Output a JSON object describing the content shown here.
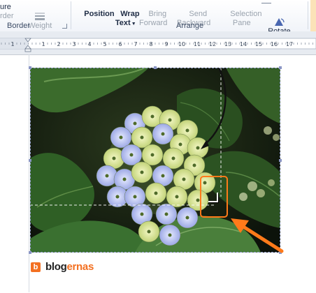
{
  "ribbon": {
    "border_group": {
      "label": "Border",
      "partial_top": "ure",
      "partial_bottom": "rder",
      "weight_label": "Weight"
    },
    "arrange_group": {
      "label": "Arrange",
      "position_label": "Position",
      "wrap_text_label": "Wrap\nText",
      "bring_forward_label": "Bring\nForward",
      "send_backward_label": "Send\nBackward",
      "selection_pane_label": "Selection\nPane",
      "rotate_label": "Rotate"
    }
  },
  "ruler": {
    "numbers": [
      "1",
      "1",
      "2",
      "3",
      "4",
      "5",
      "6",
      "7",
      "8",
      "9",
      "10",
      "11",
      "12",
      "13",
      "14",
      "15",
      "16",
      "17"
    ]
  },
  "logo": {
    "icon_letter": "b",
    "word_part1": "blog",
    "word_part2": "ernas",
    "color_dark": "#222222",
    "color_accent": "#f37021"
  },
  "colors": {
    "accent_orange": "#ff7a1a",
    "handle": "#8a95c4",
    "ribbon_text": "#1e2c45",
    "ribbon_disabled": "#9aa3ae"
  }
}
